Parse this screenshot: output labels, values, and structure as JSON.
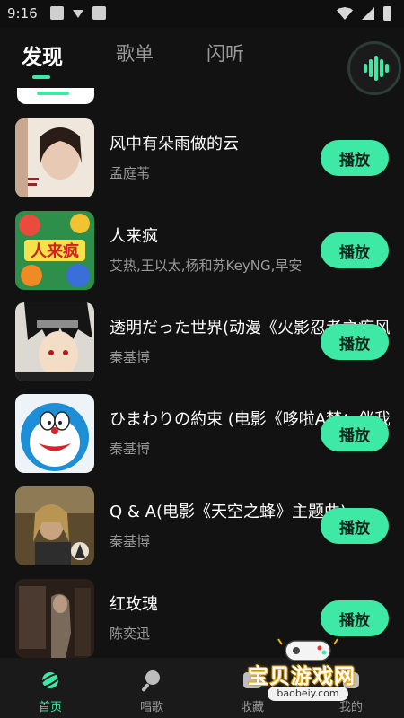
{
  "status_bar": {
    "time": "9:16"
  },
  "tabs": [
    {
      "label": "发现",
      "active": true
    },
    {
      "label": "歌单",
      "active": false
    },
    {
      "label": "闪听",
      "active": false
    }
  ],
  "accent_color": "#3ee8a5",
  "songs": [
    {
      "title": "风中有朵雨做的云",
      "artist": "孟庭苇",
      "play_label": "播放"
    },
    {
      "title": "人来疯",
      "artist": "艾热,王以太,杨和苏KeyNG,早安",
      "play_label": "播放"
    },
    {
      "title": "透明だった世界(动漫《火影忍者之疾风传》",
      "artist": "秦基博",
      "play_label": "播放"
    },
    {
      "title": "ひまわりの約束 (电影《哆啦A梦：伴我同行》",
      "artist": "秦基博",
      "play_label": "播放"
    },
    {
      "title": "Q & A(电影《天空之蜂》主题曲)",
      "artist": "秦基博",
      "play_label": "播放"
    },
    {
      "title": "红玫瑰",
      "artist": "陈奕迅",
      "play_label": "播放"
    }
  ],
  "bottom_nav": [
    {
      "label": "首页",
      "icon": "planet-icon",
      "active": true
    },
    {
      "label": "唱歌",
      "icon": "microphone-icon",
      "active": false
    },
    {
      "label": "收藏",
      "icon": "favorite-icon",
      "active": false
    },
    {
      "label": "我的",
      "icon": "profile-icon",
      "active": false
    }
  ],
  "watermark": {
    "text": "宝贝游戏网",
    "url": "baobeiy.com"
  }
}
